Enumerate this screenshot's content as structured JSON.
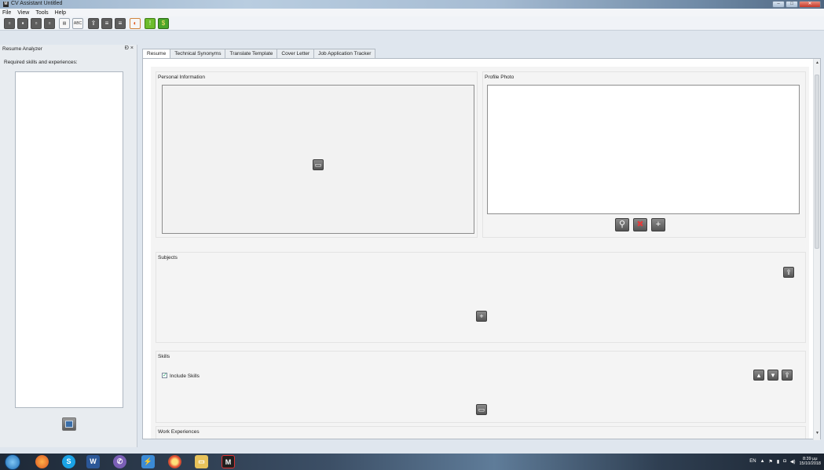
{
  "window": {
    "title": "CV Assistant Untitled",
    "app_icon": "M"
  },
  "menu": [
    "File",
    "View",
    "Tools",
    "Help"
  ],
  "toolbar": {
    "abc_label": "ABC",
    "icons": [
      "new-icon",
      "open-icon",
      "save-icon",
      "save-as-icon",
      "layout-icon",
      "spellcheck-icon",
      "export-icon",
      "list-icon",
      "list2-icon",
      "pdf-icon",
      "info-icon",
      "money-icon"
    ]
  },
  "dock": {
    "title": "Resume Analyzer",
    "controls": "Ɖ ×",
    "label": "Required skills and experiences:"
  },
  "tabs": [
    "Resume",
    "Technical Synonyms",
    "Translate Template",
    "Cover Letter",
    "Job Application Tracker"
  ],
  "resume": {
    "personal_info_title": "Personal Information",
    "profile_photo_title": "Profile Photo",
    "subjects_title": "Subjects",
    "skills_title": "Skills",
    "include_skills_label": "Include Skills",
    "include_skills_checked": true,
    "work_title": "Work Experiences"
  },
  "taskbar": {
    "apps": [
      "firefox",
      "skype",
      "word",
      "viber",
      "app",
      "chrome",
      "explorer",
      "cv-assistant"
    ],
    "tray_lang": "EN",
    "time": "8:39 μμ",
    "date": "15/10/2018"
  }
}
